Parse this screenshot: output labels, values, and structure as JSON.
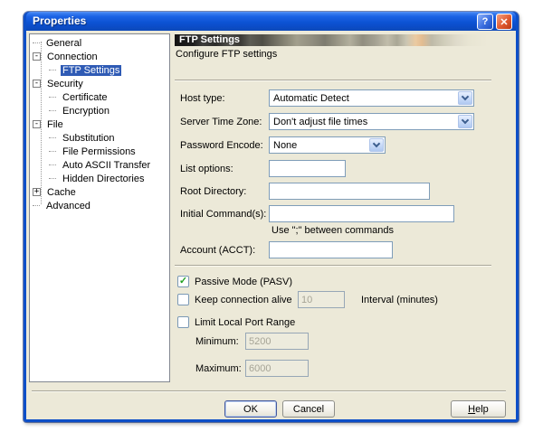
{
  "window": {
    "title": "Properties"
  },
  "icons": {
    "help_glyph": "?",
    "close_glyph": "✕",
    "check": "✓"
  },
  "tree": {
    "items": [
      {
        "label": "General",
        "level": 0,
        "expander": ""
      },
      {
        "label": "Connection",
        "level": 0,
        "expander": "-"
      },
      {
        "label": "FTP Settings",
        "level": 1,
        "expander": "",
        "selected": true
      },
      {
        "label": "Security",
        "level": 0,
        "expander": "-"
      },
      {
        "label": "Certificate",
        "level": 1,
        "expander": ""
      },
      {
        "label": "Encryption",
        "level": 1,
        "expander": ""
      },
      {
        "label": "File",
        "level": 0,
        "expander": "-"
      },
      {
        "label": "Substitution",
        "level": 1,
        "expander": ""
      },
      {
        "label": "File Permissions",
        "level": 1,
        "expander": ""
      },
      {
        "label": "Auto ASCII Transfer",
        "level": 1,
        "expander": ""
      },
      {
        "label": "Hidden Directories",
        "level": 1,
        "expander": ""
      },
      {
        "label": "Cache",
        "level": 0,
        "expander": "+"
      },
      {
        "label": "Advanced",
        "level": 0,
        "expander": ""
      }
    ]
  },
  "panel": {
    "header": "FTP Settings",
    "subtitle": "Configure FTP settings"
  },
  "form": {
    "host_type": {
      "label": "Host type:",
      "value": "Automatic Detect"
    },
    "server_time_zone": {
      "label": "Server Time Zone:",
      "value": "Don't adjust file times"
    },
    "password_encode": {
      "label": "Password Encode:",
      "value": "None"
    },
    "list_options": {
      "label": "List options:",
      "value": ""
    },
    "root_directory": {
      "label": "Root Directory:",
      "value": ""
    },
    "initial_commands": {
      "label": "Initial Command(s):",
      "value": "",
      "hint": "Use \";\" between commands"
    },
    "account": {
      "label": "Account (ACCT):",
      "value": ""
    }
  },
  "options": {
    "passive_mode": {
      "label": "Passive Mode (PASV)",
      "checked": true
    },
    "keep_alive": {
      "label": "Keep connection alive",
      "checked": false,
      "value": "10",
      "suffix": "Interval (minutes)"
    },
    "limit_ports": {
      "label": "Limit Local Port Range",
      "checked": false
    },
    "minimum": {
      "label": "Minimum:",
      "value": "5200"
    },
    "maximum": {
      "label": "Maximum:",
      "value": "6000"
    }
  },
  "buttons": {
    "ok": "OK",
    "cancel": "Cancel",
    "help_accel": "H",
    "help_rest": "elp"
  },
  "colors": {
    "titlebar_blue": "#0d4fc8",
    "dialog_bg": "#ece9d8",
    "selection": "#2f5bb5",
    "field_border": "#7f9db9",
    "check_green": "#21a121"
  }
}
